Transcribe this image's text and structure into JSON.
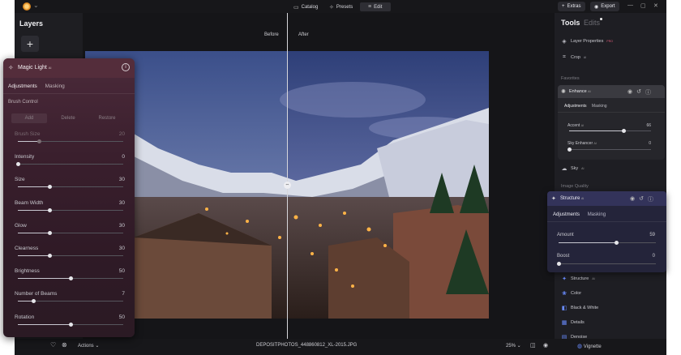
{
  "topbar": {
    "tabs": [
      {
        "label": "Catalog",
        "icon": "catalog-icon"
      },
      {
        "label": "Presets",
        "icon": "presets-icon"
      },
      {
        "label": "Edit",
        "icon": "edit-icon",
        "active": true
      }
    ],
    "extras_label": "Extras",
    "export_label": "Export"
  },
  "layers": {
    "title": "Layers",
    "add_symbol": "+"
  },
  "canvas": {
    "before_label": "Before",
    "after_label": "After",
    "filename": "DEPOSITPHOTOS_448860812_XL-2015.JPG",
    "zoom": "25%",
    "actions_label": "Actions"
  },
  "magic_light": {
    "title": "Magic Light",
    "badge": "AI",
    "tabs": [
      "Adjustments",
      "Masking"
    ],
    "brush_control_label": "Brush Control",
    "brush_buttons": [
      "Add",
      "Delete",
      "Restore"
    ],
    "sliders": [
      {
        "label": "Brush Size",
        "value": 20,
        "min": 0,
        "max": 100,
        "disabled": true
      },
      {
        "label": "Intensity",
        "value": 0,
        "min": 0,
        "max": 100
      },
      {
        "label": "Size",
        "value": 30,
        "min": 0,
        "max": 100
      },
      {
        "label": "Beam Width",
        "value": 30,
        "min": 0,
        "max": 100
      },
      {
        "label": "Glow",
        "value": 30,
        "min": 0,
        "max": 100
      },
      {
        "label": "Clearness",
        "value": 30,
        "min": 0,
        "max": 100
      },
      {
        "label": "Brightness",
        "value": 50,
        "min": 0,
        "max": 100
      },
      {
        "label": "Number of Beams",
        "value": 7,
        "min": 3,
        "max": 30
      },
      {
        "label": "Rotation",
        "value": 50,
        "min": 0,
        "max": 100
      }
    ]
  },
  "tools": {
    "title": "Tools",
    "edits_label": "Edits",
    "top_items": [
      {
        "label": "Layer Properties",
        "badge": "PRO",
        "icon": "layer-properties-icon"
      },
      {
        "label": "Crop",
        "badge": "AI",
        "icon": "crop-icon"
      }
    ],
    "favorites_label": "Favorites",
    "enhance": {
      "title": "Enhance",
      "badge": "AI",
      "tabs": [
        "Adjustments",
        "Masking"
      ],
      "sliders": [
        {
          "label": "Accent",
          "badge": "AI",
          "value": 66,
          "min": 0,
          "max": 100
        },
        {
          "label": "Sky Enhancer",
          "badge": "AI",
          "value": 0,
          "min": 0,
          "max": 100
        }
      ]
    },
    "sky_item": {
      "label": "Sky",
      "badge": "AI",
      "icon": "cloud-icon"
    },
    "image_quality_label": "Image Quality",
    "structure": {
      "title": "Structure",
      "badge": "AI",
      "tabs": [
        "Adjustments",
        "Masking"
      ],
      "sliders": [
        {
          "label": "Amount",
          "value": 59,
          "min": 0,
          "max": 100
        },
        {
          "label": "Boost",
          "value": 0,
          "min": 0,
          "max": 100
        }
      ]
    },
    "list_items": [
      {
        "label": "Structure",
        "badge": "AI",
        "icon": "structure-icon"
      },
      {
        "label": "Color",
        "icon": "color-icon"
      },
      {
        "label": "Black & White",
        "icon": "black-white-icon"
      },
      {
        "label": "Details",
        "icon": "details-icon"
      },
      {
        "label": "Denoise",
        "icon": "denoise-icon"
      },
      {
        "label": "Vignette",
        "icon": "vignette-icon"
      }
    ]
  }
}
